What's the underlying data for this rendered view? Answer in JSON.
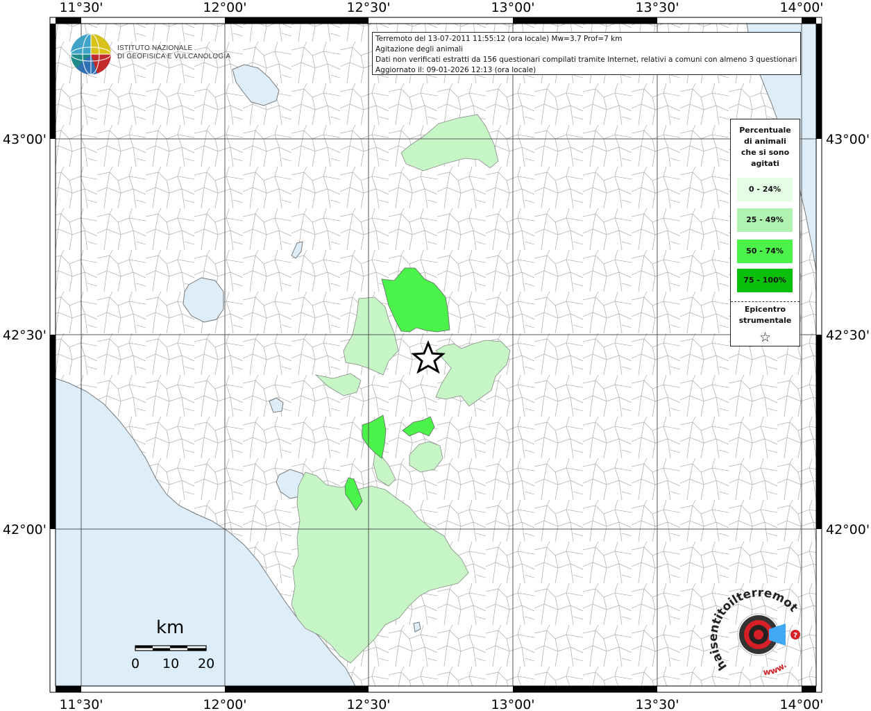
{
  "header": {
    "line1": "Terremoto del 13-07-2011 11:55:12 (ora locale) Mw=3.7 Prof=7 km",
    "line2": "Agitazione degli animali",
    "line3": "Dati non verificati estratti da 156 questionari compilati tramite Internet, relativi a comuni con almeno 3 questionari.",
    "line4": "Aggiornato il: 09-01-2026 12:13 (ora locale)"
  },
  "logo": {
    "line1": "ISTITUTO NAZIONALE",
    "line2": "DI GEOFISICA E VULCANOLOGIA"
  },
  "axes": {
    "lon_ticks": [
      "11°30'",
      "12°00'",
      "12°30'",
      "13°00'",
      "13°30'",
      "14°00'"
    ],
    "lat_ticks": [
      "43°00'",
      "42°30'",
      "42°00'"
    ]
  },
  "legend": {
    "title": [
      "Percentuale",
      "di animali",
      "che si sono",
      "agitati"
    ],
    "classes": [
      {
        "label": "0 - 24%",
        "color": "#e4fde4"
      },
      {
        "label": "25 - 49%",
        "color": "#b0f2b0"
      },
      {
        "label": "50 - 74%",
        "color": "#4af24a"
      },
      {
        "label": "75 - 100%",
        "color": "#0ac00a"
      }
    ],
    "epicenter_title": [
      "Epicentro",
      "strumentale"
    ],
    "epicenter_symbol": "☆"
  },
  "scale_bar": {
    "unit": "km",
    "ticks": [
      "0",
      "10",
      "20"
    ]
  },
  "badge": {
    "text": "haisentitoilterremoto.it",
    "url_text": "www."
  },
  "colors": {
    "sea": "#ddeefa",
    "land": "#ffffff",
    "boundary": "#a8a8a8",
    "grid": "#555555",
    "class_25_49": "#c6f5c6",
    "class_50_74": "#4af24a"
  }
}
